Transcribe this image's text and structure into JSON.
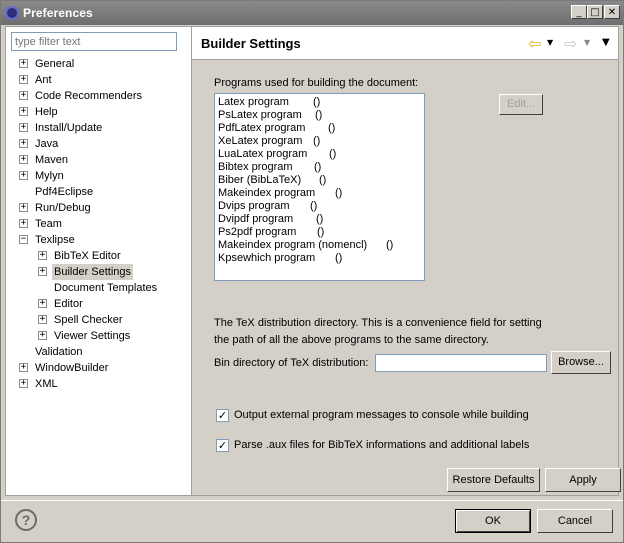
{
  "window": {
    "title": "Preferences"
  },
  "filter": {
    "placeholder": "type filter text"
  },
  "tree": [
    {
      "label": "General",
      "expander": "+"
    },
    {
      "label": "Ant",
      "expander": "+"
    },
    {
      "label": "Code Recommenders",
      "expander": "+"
    },
    {
      "label": "Help",
      "expander": "+"
    },
    {
      "label": "Install/Update",
      "expander": "+"
    },
    {
      "label": "Java",
      "expander": "+"
    },
    {
      "label": "Maven",
      "expander": "+"
    },
    {
      "label": "Mylyn",
      "expander": "+"
    },
    {
      "label": "Pdf4Eclipse",
      "expander": ""
    },
    {
      "label": "Run/Debug",
      "expander": "+"
    },
    {
      "label": "Team",
      "expander": "+"
    },
    {
      "label": "Texlipse",
      "expander": "−"
    },
    {
      "label": "BibTeX Editor",
      "expander": "+"
    },
    {
      "label": "Builder Settings",
      "expander": "+"
    },
    {
      "label": "Document Templates",
      "expander": ""
    },
    {
      "label": "Editor",
      "expander": "+"
    },
    {
      "label": "Spell Checker",
      "expander": "+"
    },
    {
      "label": "Viewer Settings",
      "expander": "+"
    },
    {
      "label": "Validation",
      "expander": ""
    },
    {
      "label": "WindowBuilder",
      "expander": "+"
    },
    {
      "label": "XML",
      "expander": "+"
    }
  ],
  "page": {
    "title": "Builder Settings",
    "programs_label": "Programs used for building the document:",
    "programs": [
      {
        "name": "Latex program",
        "path": "()"
      },
      {
        "name": "PsLatex program",
        "path": "()"
      },
      {
        "name": "PdfLatex program",
        "path": "()"
      },
      {
        "name": "XeLatex program",
        "path": "()"
      },
      {
        "name": "LuaLatex program",
        "path": "()"
      },
      {
        "name": "Bibtex program",
        "path": "()"
      },
      {
        "name": "Biber (BibLaTeX)",
        "path": "()"
      },
      {
        "name": "Makeindex program",
        "path": "()"
      },
      {
        "name": "Dvips program",
        "path": "()"
      },
      {
        "name": "Dvipdf program",
        "path": "()"
      },
      {
        "name": "Ps2pdf program",
        "path": "()"
      },
      {
        "name": "Makeindex program (nomencl)",
        "path": "()"
      },
      {
        "name": "Kpsewhich program",
        "path": "()"
      }
    ],
    "edit_label": "Edit...",
    "tex_desc_line1": "The TeX distribution directory. This is a convenience field for setting",
    "tex_desc_line2": "the path of all the above programs to the same directory.",
    "bin_label": "Bin directory of TeX distribution:",
    "bin_value": "",
    "browse_label": "Browse...",
    "check1_label": "Output external program messages to console while building",
    "check1_checked": true,
    "check2_label": "Parse .aux files for BibTeX informations and additional labels",
    "check2_checked": true,
    "restore_label": "Restore Defaults",
    "apply_label": "Apply"
  },
  "footer": {
    "ok_label": "OK",
    "cancel_label": "Cancel"
  },
  "icons": {
    "back": "back-arrow-icon",
    "forward": "forward-arrow-icon",
    "menu": "view-menu-icon",
    "help": "help-icon"
  },
  "colors": {
    "accent_back_arrow": "#e8b020"
  }
}
